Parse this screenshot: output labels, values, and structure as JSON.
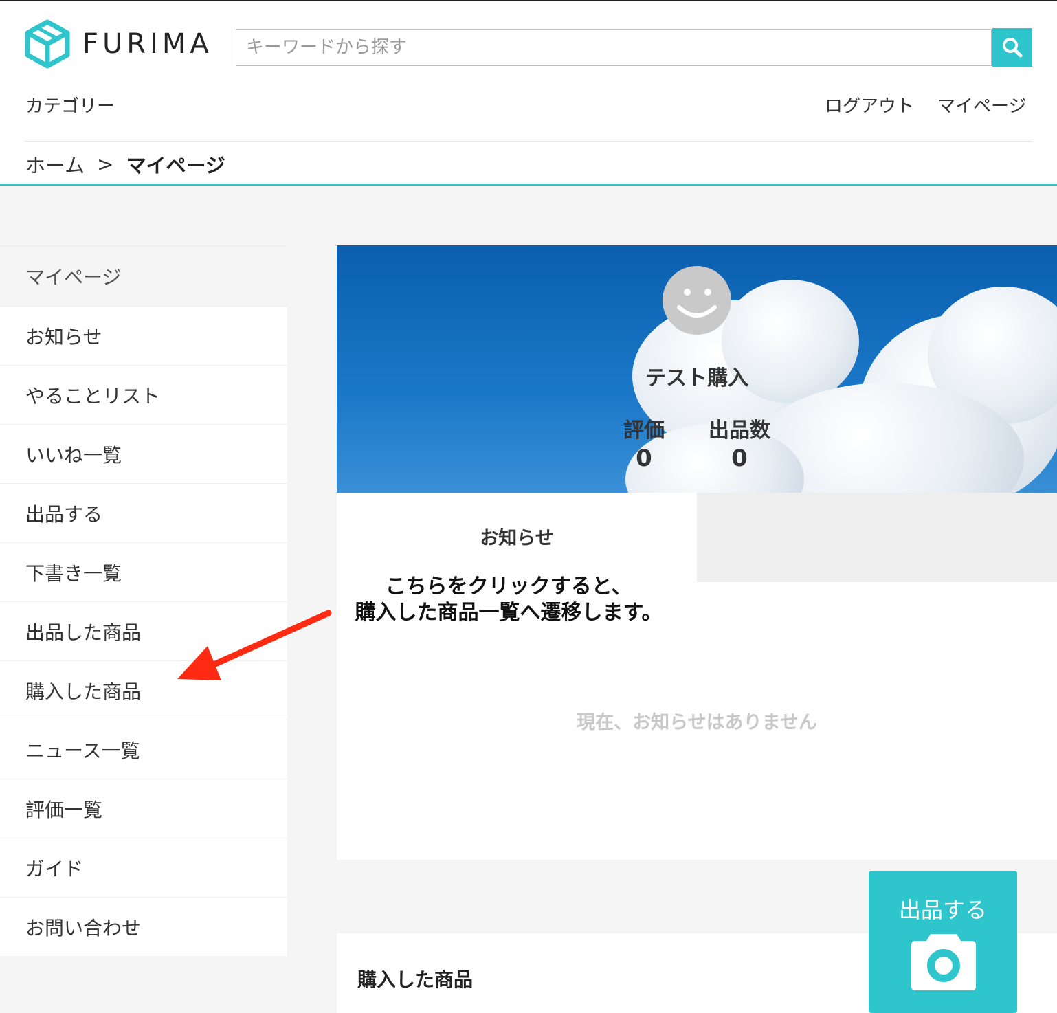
{
  "header": {
    "brand": "FURIMA",
    "search_placeholder": "キーワードから探す",
    "category_label": "カテゴリー",
    "logout_label": "ログアウト",
    "mypage_label": "マイページ"
  },
  "breadcrumb": {
    "home": "ホーム",
    "separator": ">",
    "current": "マイページ"
  },
  "sidebar": {
    "heading": "マイページ",
    "items": [
      {
        "label": "お知らせ"
      },
      {
        "label": "やることリスト"
      },
      {
        "label": "いいね一覧"
      },
      {
        "label": "出品する"
      },
      {
        "label": "下書き一覧"
      },
      {
        "label": "出品した商品"
      },
      {
        "label": "購入した商品"
      },
      {
        "label": "ニュース一覧"
      },
      {
        "label": "評価一覧"
      },
      {
        "label": "ガイド"
      },
      {
        "label": "お問い合わせ"
      }
    ]
  },
  "profile": {
    "name": "テスト購入",
    "rating_label": "評価",
    "rating_value": "0",
    "listings_label": "出品数",
    "listings_value": "0"
  },
  "notice": {
    "title": "お知らせ",
    "empty_message": "現在、お知らせはありません"
  },
  "annotation": {
    "line1": "こちらをクリックすると、",
    "line2": "購入した商品一覧へ遷移します。"
  },
  "purchased": {
    "title": "購入した商品"
  },
  "sell_button": {
    "label": "出品する"
  },
  "colors": {
    "accent": "#2ec5cc",
    "arrow": "#ff2a12"
  }
}
